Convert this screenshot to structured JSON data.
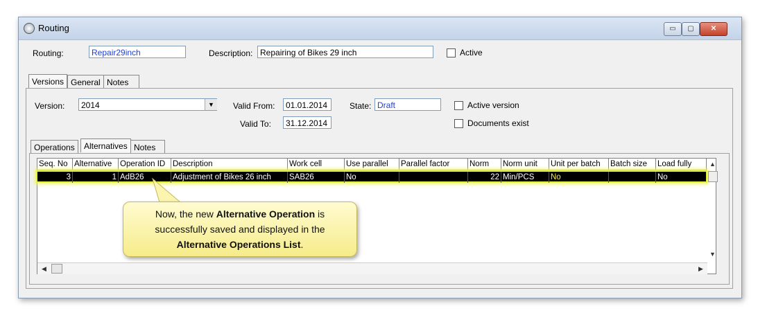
{
  "window": {
    "title": "Routing",
    "minimize": "▭",
    "maximize": "▢",
    "close": "✕"
  },
  "routing": {
    "routing_label": "Routing:",
    "routing_value": "Repair29inch",
    "description_label": "Description:",
    "description_value": "Repairing of Bikes 29 inch",
    "active_label": "Active"
  },
  "outer_tabs": [
    "Versions",
    "General",
    "Notes"
  ],
  "version": {
    "version_label": "Version:",
    "version_value": "2014",
    "valid_from_label": "Valid From:",
    "valid_from_value": "01.01.2014",
    "valid_to_label": "Valid To:",
    "valid_to_value": "31.12.2014",
    "state_label": "State:",
    "state_value": "Draft",
    "active_version_label": "Active version",
    "documents_exist_label": "Documents exist"
  },
  "inner_tabs": [
    "Operations",
    "Alternatives",
    "Notes"
  ],
  "table": {
    "columns": [
      "Seq. No",
      "Alternative",
      "Operation ID",
      "Description",
      "Work cell",
      "Use parallel",
      "Parallel factor",
      "Norm",
      "Norm unit",
      "Unit per batch",
      "Batch size",
      "Load fully"
    ],
    "rows": [
      [
        "3",
        "1",
        "AdB26",
        "Adjustment of Bikes 26 inch",
        "SAB26",
        "No",
        "",
        "22",
        "Min/PCS",
        "No",
        "",
        "No"
      ]
    ]
  },
  "callout": {
    "line1_pre": "Now, the new ",
    "line1_bold": "Alternative Operation",
    "line1_post": " is",
    "line2": "successfully saved and displayed in the",
    "line3_bold": "Alternative Operations List",
    "line3_post": "."
  },
  "colors": {
    "highlight": "#e8f23a",
    "row_bg": "#000000"
  }
}
